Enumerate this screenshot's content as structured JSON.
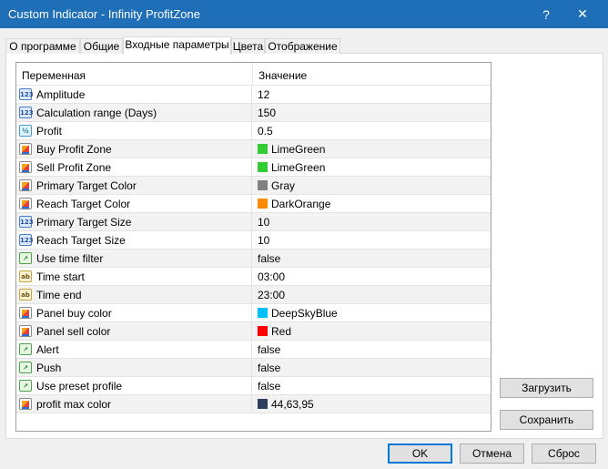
{
  "window": {
    "title": "Custom Indicator - Infinity ProfitZone",
    "help_label": "?",
    "close_label": "✕"
  },
  "tabs": [
    {
      "label": "О программе"
    },
    {
      "label": "Общие"
    },
    {
      "label": "Входные параметры",
      "active": true
    },
    {
      "label": "Цвета"
    },
    {
      "label": "Отображение"
    }
  ],
  "grid": {
    "columns": {
      "variable": "Переменная",
      "value": "Значение"
    },
    "rows": [
      {
        "type": "int",
        "icon": "integer-icon",
        "icon_text": "123",
        "label": "Amplitude",
        "value": "12"
      },
      {
        "type": "int",
        "icon": "integer-icon",
        "icon_text": "123",
        "label": "Calculation range (Days)",
        "value": "150"
      },
      {
        "type": "dbl",
        "icon": "double-icon",
        "icon_text": "½",
        "label": "Profit",
        "value": "0.5"
      },
      {
        "type": "col",
        "icon": "color-icon",
        "icon_text": "",
        "label": "Buy Profit Zone",
        "value": "LimeGreen",
        "swatch": "#32cd32"
      },
      {
        "type": "col",
        "icon": "color-icon",
        "icon_text": "",
        "label": "Sell Profit Zone",
        "value": "LimeGreen",
        "swatch": "#32cd32"
      },
      {
        "type": "col",
        "icon": "color-icon",
        "icon_text": "",
        "label": "Primary Target Color",
        "value": "Gray",
        "swatch": "#808080"
      },
      {
        "type": "col",
        "icon": "color-icon",
        "icon_text": "",
        "label": "Reach Target Color",
        "value": "DarkOrange",
        "swatch": "#ff8c00"
      },
      {
        "type": "int",
        "icon": "integer-icon",
        "icon_text": "123",
        "label": "Primary Target Size",
        "value": "10"
      },
      {
        "type": "int",
        "icon": "integer-icon",
        "icon_text": "123",
        "label": "Reach Target Size",
        "value": "10"
      },
      {
        "type": "bool",
        "icon": "boolean-icon",
        "icon_text": "↗",
        "label": "Use time filter",
        "value": "false"
      },
      {
        "type": "str",
        "icon": "string-icon",
        "icon_text": "ab",
        "label": "Time start",
        "value": "03:00"
      },
      {
        "type": "str",
        "icon": "string-icon",
        "icon_text": "ab",
        "label": "Time end",
        "value": "23:00"
      },
      {
        "type": "col",
        "icon": "color-icon",
        "icon_text": "",
        "label": "Panel buy color",
        "value": "DeepSkyBlue",
        "swatch": "#00bfff"
      },
      {
        "type": "col",
        "icon": "color-icon",
        "icon_text": "",
        "label": "Panel sell color",
        "value": "Red",
        "swatch": "#ff0000"
      },
      {
        "type": "bool",
        "icon": "boolean-icon",
        "icon_text": "↗",
        "label": "Alert",
        "value": "false"
      },
      {
        "type": "bool",
        "icon": "boolean-icon",
        "icon_text": "↗",
        "label": "Push",
        "value": "false"
      },
      {
        "type": "bool",
        "icon": "boolean-icon",
        "icon_text": "↗",
        "label": "Use preset profile",
        "value": "false"
      },
      {
        "type": "col",
        "icon": "color-icon",
        "icon_text": "",
        "label": "profit max color",
        "value": "44,63,95",
        "swatch": "#2c3f5f"
      }
    ]
  },
  "buttons": {
    "load": "Загрузить",
    "save": "Сохранить",
    "ok": "OK",
    "cancel": "Отмена",
    "reset": "Сброс"
  },
  "colors": {
    "titlebar": "#1e6fb8",
    "ok_border": "#0078d7"
  }
}
